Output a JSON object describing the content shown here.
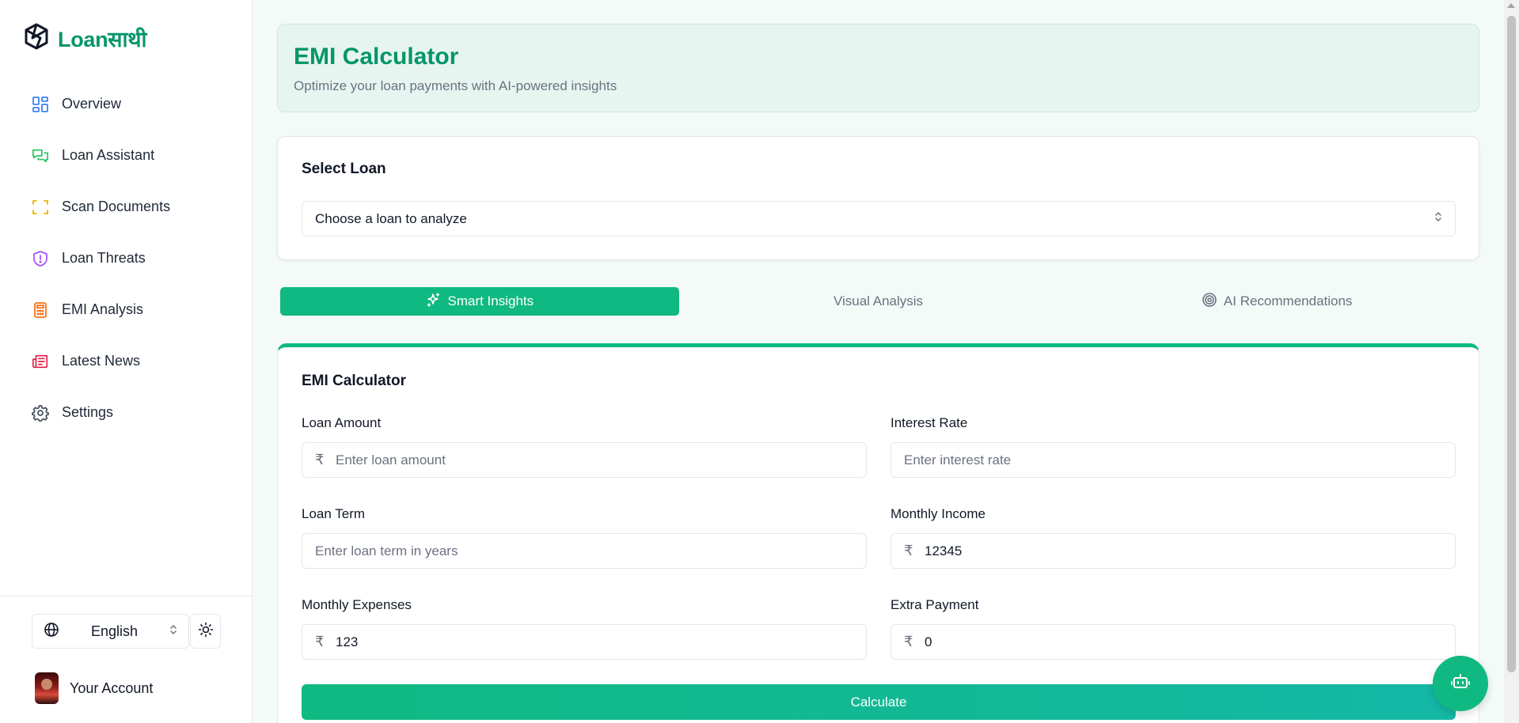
{
  "app": {
    "brand": "Loanसाथी",
    "brand_color": "#059669",
    "accent_color": "#10b981"
  },
  "sidebar": {
    "items": [
      {
        "label": "Overview",
        "icon": "layout-grid-icon",
        "color": "#3b82f6"
      },
      {
        "label": "Loan Assistant",
        "icon": "chat-bubbles-icon",
        "color": "#22c55e"
      },
      {
        "label": "Scan Documents",
        "icon": "scan-icon",
        "color": "#eab308"
      },
      {
        "label": "Loan Threats",
        "icon": "shield-alert-icon",
        "color": "#a855f7"
      },
      {
        "label": "EMI Analysis",
        "icon": "calculator-icon",
        "color": "#f97316"
      },
      {
        "label": "Latest News",
        "icon": "newspaper-icon",
        "color": "#e11d48"
      },
      {
        "label": "Settings",
        "icon": "gear-icon",
        "color": "#4b5563"
      }
    ],
    "language": "English",
    "account_label": "Your Account"
  },
  "header": {
    "title": "EMI Calculator",
    "subtitle": "Optimize your loan payments with AI-powered insights"
  },
  "select_loan": {
    "title": "Select Loan",
    "value": "Choose a loan to analyze"
  },
  "tabs": [
    {
      "label": "Smart Insights",
      "icon": "sparkles-icon",
      "active": true
    },
    {
      "label": "Visual Analysis",
      "icon": "",
      "active": false
    },
    {
      "label": "AI Recommendations",
      "icon": "target-icon",
      "active": false
    }
  ],
  "calculator": {
    "title": "EMI Calculator",
    "currency_symbol": "₹",
    "fields": {
      "loan_amount": {
        "label": "Loan Amount",
        "value": "",
        "placeholder": "Enter loan amount"
      },
      "interest_rate": {
        "label": "Interest Rate",
        "value": "",
        "placeholder": "Enter interest rate"
      },
      "loan_term": {
        "label": "Loan Term",
        "value": "",
        "placeholder": "Enter loan term in years"
      },
      "monthly_income": {
        "label": "Monthly Income",
        "value": "12345",
        "placeholder": ""
      },
      "monthly_expenses": {
        "label": "Monthly Expenses",
        "value": "123",
        "placeholder": ""
      },
      "extra_payment": {
        "label": "Extra Payment",
        "value": "0",
        "placeholder": ""
      }
    },
    "button_label": "Calculate"
  },
  "chat_fab_icon": "bot-icon"
}
